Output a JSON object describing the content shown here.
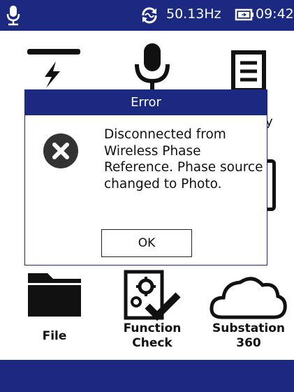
{
  "status_bar": {
    "icons": [
      "microphone-icon",
      "phase-sync-icon",
      "battery-icon"
    ],
    "frequency": "50.13Hz",
    "time": "09:42"
  },
  "menu": {
    "items": [
      {
        "label": "",
        "icon": "lightning-line-icon"
      },
      {
        "label": "",
        "icon": "microphone-icon"
      },
      {
        "label": "",
        "icon": "document-icon"
      },
      {
        "label": "File",
        "icon": "folder-icon"
      },
      {
        "label": "Function\nCheck",
        "icon": "function-check-icon"
      },
      {
        "label": "Substation\n360",
        "icon": "cloud-icon"
      }
    ]
  },
  "dialog": {
    "title": "Error",
    "icon": "error-x-icon",
    "message": "Disconnected from Wireless Phase Reference. Phase source changed to Photo.",
    "ok_label": "OK"
  },
  "colors": {
    "bar": "#1b2a80",
    "icon": "#111111",
    "error_icon": "#333333"
  }
}
